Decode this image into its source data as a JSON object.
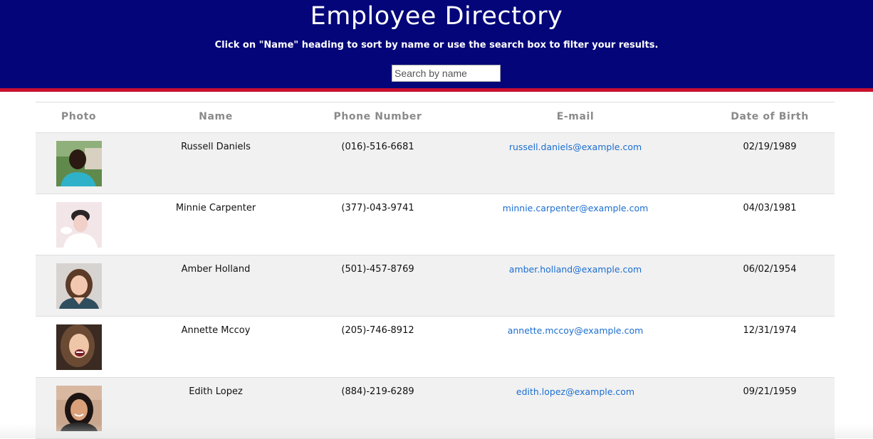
{
  "header": {
    "title": "Employee Directory",
    "subtitle": "Click on \"Name\" heading to sort by name or use the search box to filter your results.",
    "search_placeholder": "Search by name"
  },
  "table": {
    "columns": [
      "Photo",
      "Name",
      "Phone Number",
      "E-mail",
      "Date of Birth"
    ],
    "rows": [
      {
        "name": "Russell Daniels",
        "phone": "(016)-516-6681",
        "email": "russell.daniels@example.com",
        "dob": "02/19/1989"
      },
      {
        "name": "Minnie Carpenter",
        "phone": "(377)-043-9741",
        "email": "minnie.carpenter@example.com",
        "dob": "04/03/1981"
      },
      {
        "name": "Amber Holland",
        "phone": "(501)-457-8769",
        "email": "amber.holland@example.com",
        "dob": "06/02/1954"
      },
      {
        "name": "Annette Mccoy",
        "phone": "(205)-746-8912",
        "email": "annette.mccoy@example.com",
        "dob": "12/31/1974"
      },
      {
        "name": "Edith Lopez",
        "phone": "(884)-219-6289",
        "email": "edith.lopez@example.com",
        "dob": "09/21/1959"
      }
    ]
  },
  "colors": {
    "header_bg": "#040579",
    "header_border": "#c8102e",
    "link": "#1b6ed1",
    "stripe": "#f1f1f1"
  }
}
